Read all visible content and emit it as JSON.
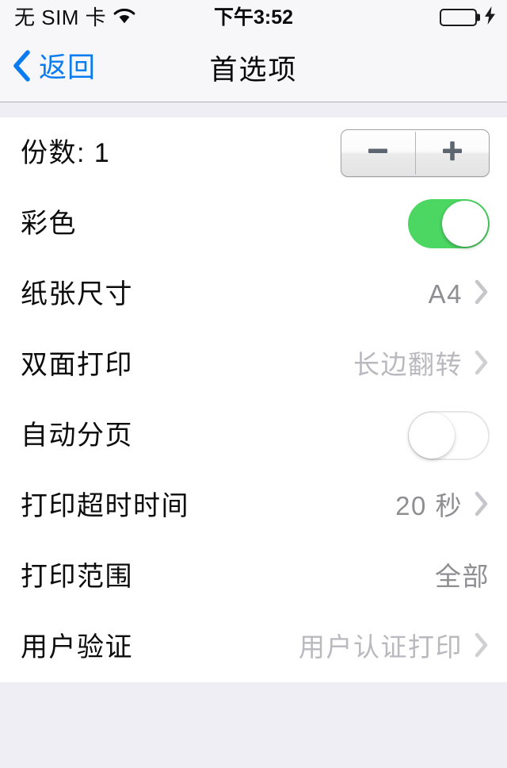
{
  "status_bar": {
    "carrier": "无 SIM 卡",
    "wifi_icon": "wifi-icon",
    "time": "下午3:52",
    "battery_icon": "battery-full-icon",
    "battery_level_percent": 100,
    "charging_icon": "lightning-bolt-icon",
    "battery_color": "#4cd662"
  },
  "nav_bar": {
    "back_icon": "chevron-left-icon",
    "back_label": "返回",
    "title": "首选项",
    "accent_color": "#0a7cf0"
  },
  "settings": {
    "rows": [
      {
        "label": "份数: 1",
        "control": "stepper",
        "stepper": {
          "decrement_label": "−",
          "increment_label": "+",
          "value": 1
        }
      },
      {
        "label": "彩色",
        "control": "switch",
        "switch_state": "on"
      },
      {
        "label": "纸张尺寸",
        "control": "disclosure",
        "value": "A4",
        "value_tone": "dark",
        "chevron": true
      },
      {
        "label": "双面打印",
        "control": "disclosure",
        "value": "长边翻转",
        "value_tone": "light",
        "chevron": true
      },
      {
        "label": "自动分页",
        "control": "switch",
        "switch_state": "off"
      },
      {
        "label": "打印超时时间",
        "control": "disclosure",
        "value": "20 秒",
        "value_tone": "dark",
        "chevron": true
      },
      {
        "label": "打印范围",
        "control": "value",
        "value": "全部",
        "value_tone": "dark",
        "chevron": false
      },
      {
        "label": "用户验证",
        "control": "disclosure",
        "value": "用户认证打印",
        "value_tone": "light",
        "chevron": true
      }
    ]
  },
  "colors": {
    "page_background": "#eeeef4",
    "bar_background": "#f7f7f9",
    "list_background": "#ffffff",
    "switch_on": "#4cd662",
    "value_dark": "#8e8e93",
    "value_light": "#b9b9bf",
    "chevron": "#c5c5cb"
  }
}
